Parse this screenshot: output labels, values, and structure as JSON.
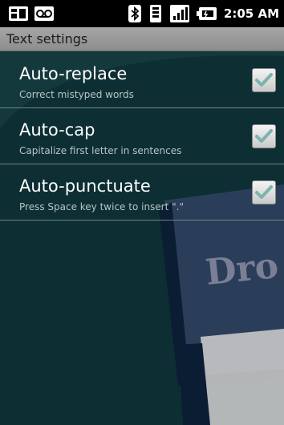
{
  "status_bar": {
    "time": "2:05 AM",
    "icons": [
      "notification-icon",
      "voicemail-icon",
      "bluetooth-icon",
      "vibrate-icon",
      "signal-icon",
      "battery-icon"
    ]
  },
  "title_bar": {
    "title": "Text settings"
  },
  "settings": [
    {
      "title": "Auto-replace",
      "summary": "Correct mistyped words",
      "checked": true
    },
    {
      "title": "Auto-cap",
      "summary": "Capitalize first letter in sentences",
      "checked": true
    },
    {
      "title": "Auto-punctuate",
      "summary": "Press Space key twice to insert \".\"",
      "checked": true
    }
  ],
  "wallpaper": {
    "text": "Dro"
  },
  "colors": {
    "background": "#0d2f33",
    "title_bar": "#9a9a9a",
    "check": "#7fb1ae"
  }
}
